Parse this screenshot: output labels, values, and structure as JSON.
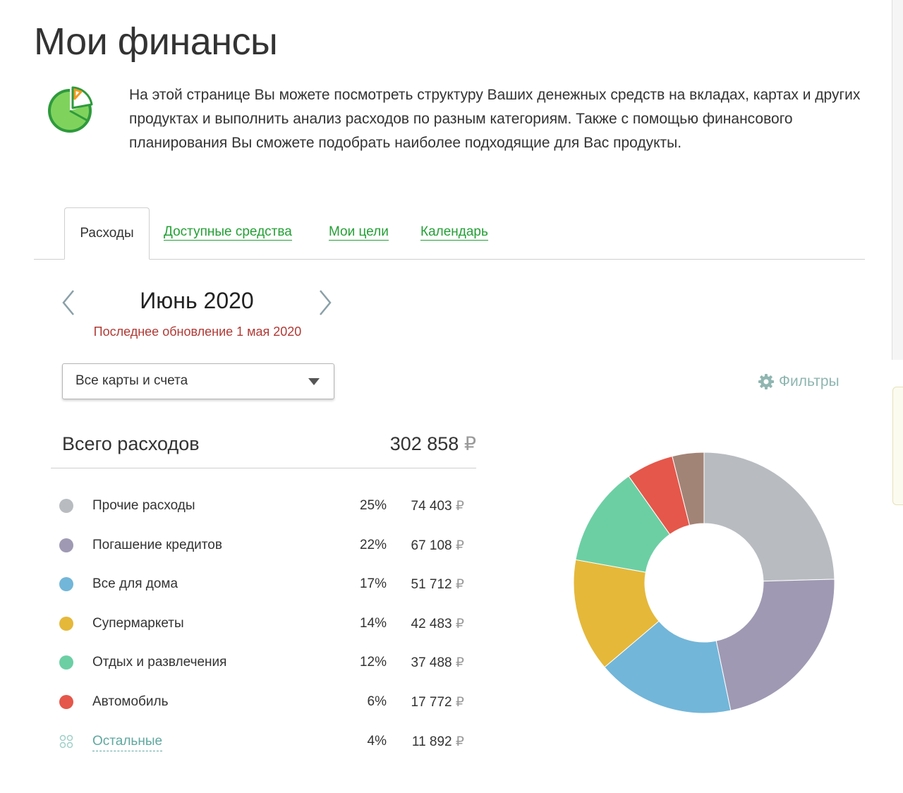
{
  "header": {
    "title": "Мои финансы",
    "description": "На этой странице Вы можете посмотреть структуру Ваших денежных средств на вкладах, картах и других продуктах и выполнить анализ расходов по разным категориям. Также с помощью финансового планирования Вы сможете подобрать наиболее подходящие для Вас продукты."
  },
  "tabs": [
    {
      "label": "Расходы",
      "active": true
    },
    {
      "label": "Доступные средства",
      "active": false
    },
    {
      "label": "Мои цели",
      "active": false
    },
    {
      "label": "Календарь",
      "active": false
    }
  ],
  "period": {
    "month": "Июнь 2020",
    "last_update": "Последнее обновление 1 мая 2020"
  },
  "account_select": {
    "selected": "Все карты и счета"
  },
  "filters": {
    "label": "Фильтры",
    "icon": "gear-icon"
  },
  "total": {
    "label": "Всего расходов",
    "amount": "302 858",
    "currency": "₽"
  },
  "categories": [
    {
      "name": "Прочие расходы",
      "percent": "25%",
      "amount": "74 403",
      "currency": "₽",
      "color": "#b8bcc0",
      "icon": "dot"
    },
    {
      "name": "Погашение кредитов",
      "percent": "22%",
      "amount": "67 108",
      "currency": "₽",
      "color": "#9f99b3",
      "icon": "dot"
    },
    {
      "name": "Все для дома",
      "percent": "17%",
      "amount": "51 712",
      "currency": "₽",
      "color": "#72b6d9",
      "icon": "dot"
    },
    {
      "name": "Супермаркеты",
      "percent": "14%",
      "amount": "42 483",
      "currency": "₽",
      "color": "#e5b83a",
      "icon": "dot"
    },
    {
      "name": "Отдых и развлечения",
      "percent": "12%",
      "amount": "37 488",
      "currency": "₽",
      "color": "#6ccfa4",
      "icon": "dot"
    },
    {
      "name": "Автомобиль",
      "percent": "6%",
      "amount": "17 772",
      "currency": "₽",
      "color": "#e5574a",
      "icon": "dot"
    },
    {
      "name": "Остальные",
      "percent": "4%",
      "amount": "11 892",
      "currency": "₽",
      "color": "#a28476",
      "icon": "grid-dots-icon",
      "link": true
    }
  ],
  "colors": {
    "accent_green": "#24a036",
    "alert_red": "#b03a35",
    "filter_teal": "#8fb6b0"
  }
}
